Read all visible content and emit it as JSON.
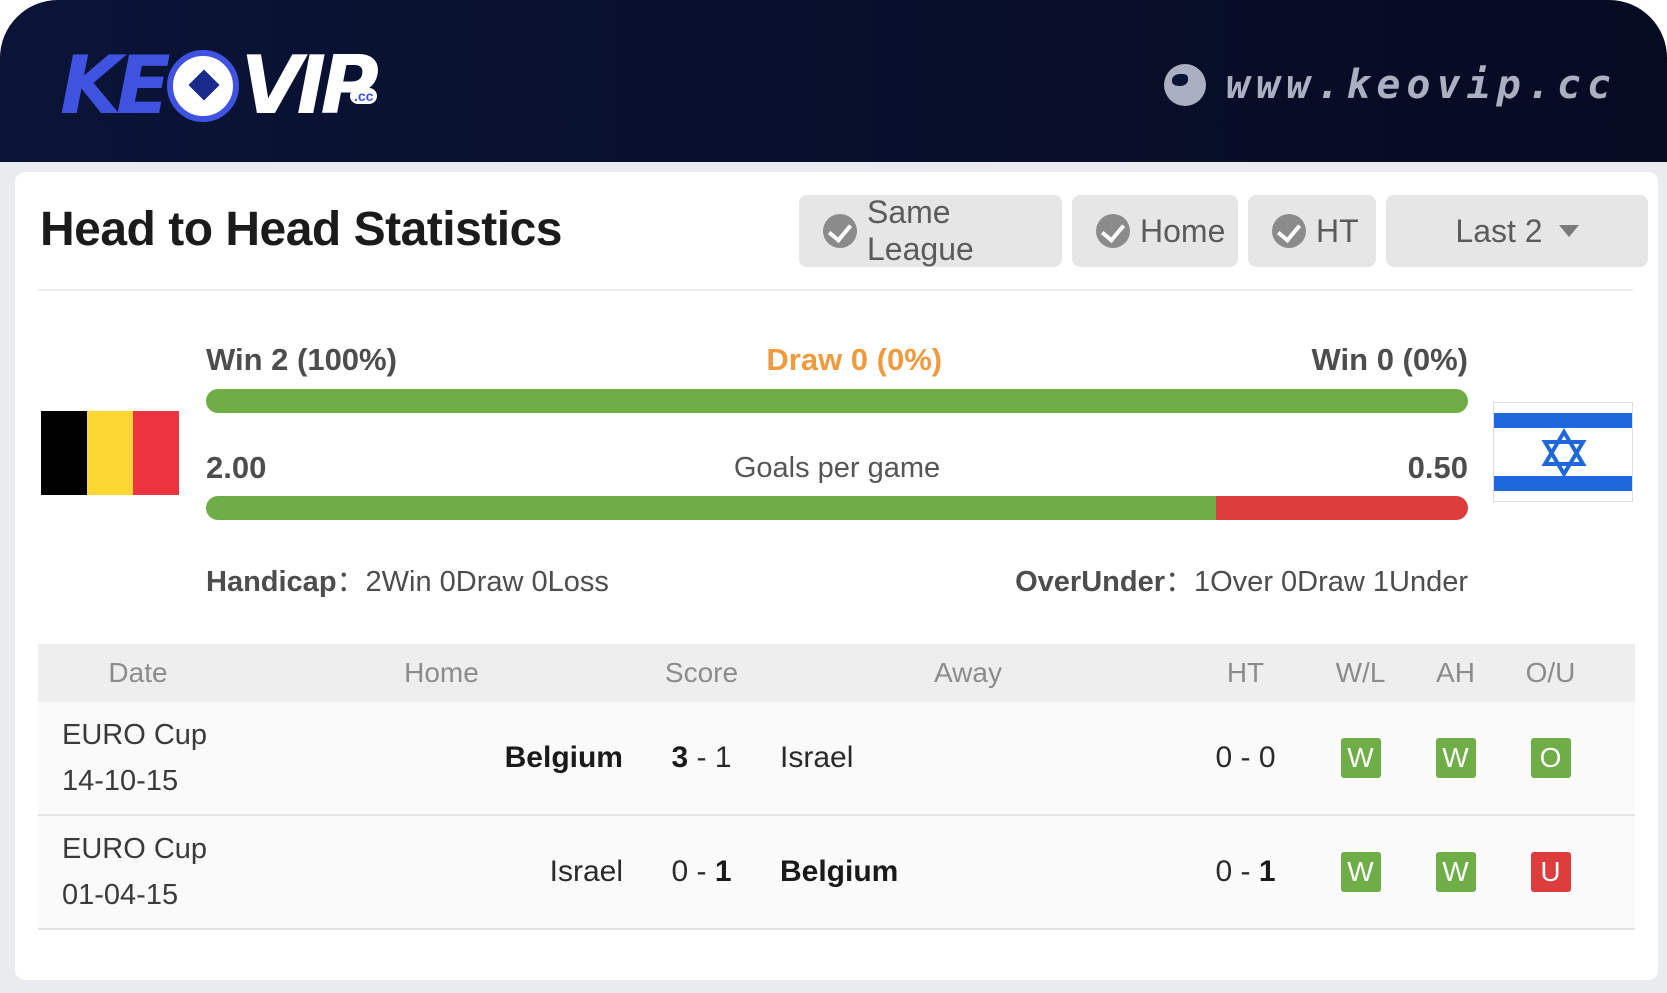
{
  "brand": {
    "logo_text_a": "KE",
    "logo_text_b": "VIP",
    "logo_suffix": ".cc",
    "site_url": "www.keovip.cc"
  },
  "colors": {
    "header_bg": "#0b1437",
    "win_bar": "#6fad47",
    "loss_bar": "#dd3d3d",
    "draw_text": "#f09a3e",
    "badge_win": "#6fad47",
    "badge_under": "#dd3d3d"
  },
  "section": {
    "title": "Head to Head Statistics",
    "filters": {
      "same_league": "Same League",
      "home": "Home",
      "ht": "HT",
      "last": "Last 2"
    }
  },
  "summary": {
    "home_win": "Win 2 (100%)",
    "draw": "Draw 0 (0%)",
    "away_win": "Win 0 (0%)",
    "home_win_share": 1.0,
    "home_goals": "2.00",
    "goals_label": "Goals per game",
    "away_goals": "0.50",
    "home_goals_share": 0.8,
    "handicap_label": "Handicap",
    "handicap_value": "2Win 0Draw 0Loss",
    "overunder_label": "OverUnder",
    "overunder_value": "1Over 0Draw 1Under",
    "home_flag": "belgium-flag",
    "away_flag": "israel-flag"
  },
  "table": {
    "headers": {
      "date": "Date",
      "home": "Home",
      "score": "Score",
      "away": "Away",
      "ht": "HT",
      "wl": "W/L",
      "ah": "AH",
      "ou": "O/U"
    },
    "rows": [
      {
        "league": "EURO Cup",
        "date": "14-10-15",
        "home": "Belgium",
        "score_home": "3",
        "score_sep": " - ",
        "score_away": "1",
        "away": "Israel",
        "ht_home": "0",
        "ht_sep": " - ",
        "ht_away": "0",
        "wl": "W",
        "ah": "W",
        "ou": "O"
      },
      {
        "league": "EURO Cup",
        "date": "01-04-15",
        "home": "Israel",
        "score_home": "0",
        "score_sep": " - ",
        "score_away": "1",
        "away": "Belgium",
        "ht_home": "0",
        "ht_sep": " - ",
        "ht_away": "1",
        "wl": "W",
        "ah": "W",
        "ou": "U"
      }
    ]
  }
}
